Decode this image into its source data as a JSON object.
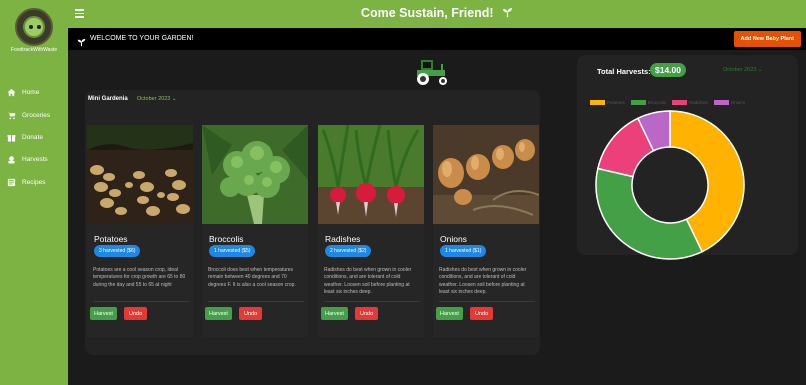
{
  "sidebar": {
    "brand": "FoodtrackWithWaste",
    "items": [
      {
        "label": "Home",
        "icon": "home-icon"
      },
      {
        "label": "Groceries",
        "icon": "cart-icon"
      },
      {
        "label": "Donate",
        "icon": "gift-icon"
      },
      {
        "label": "Harvests",
        "icon": "harvest-icon"
      },
      {
        "label": "Recipes",
        "icon": "recipes-icon"
      }
    ]
  },
  "header": {
    "title": "Come Sustain, Friend!",
    "sprout_icon": "sprout-icon",
    "menu_icon": "menu-icon"
  },
  "welcome": {
    "text": "WELCOME TO YOUR GARDEN!",
    "add_button": "Add New Baby Plant"
  },
  "garden": {
    "name": "Mini Gardenia",
    "month": "October 2023",
    "cards": [
      {
        "title": "Potatoes",
        "badge": "3 harvested ($6)",
        "description": "Potatoes are a cool season crop, ideal temperatures for crop growth are 65 to 80 during the day and 55 to 65 at night",
        "harvest": "Harvest",
        "undo": "Undo"
      },
      {
        "title": "Broccolis",
        "badge": "1 harvested ($5)",
        "description": "Broccoli does best when temperatures remain between 40 degrees and 70 degrees F. It is also a cool season crop.",
        "harvest": "Harvest",
        "undo": "Undo"
      },
      {
        "title": "Radishes",
        "badge": "2 harvested ($2)",
        "description": "Radishes do best when grown in cooler conditions, and are tolerant of cold weather. Loosen soil before planting at least six inches deep.",
        "harvest": "Harvest",
        "undo": "Undo"
      },
      {
        "title": "Onions",
        "badge": "1 harvested ($1)",
        "description": "Radishes do best when grown in cooler conditions, and are tolerant of cold weather. Loosen soil before planting at least six inches deep.",
        "harvest": "Harvest",
        "undo": "Undo"
      }
    ]
  },
  "harvest_summary": {
    "label": "Total Harvests:",
    "total": "$14.00",
    "month": "October 2023"
  },
  "chart_data": {
    "type": "pie",
    "categories": [
      "Potatoes",
      "Broccolis",
      "Radishes",
      "Onions"
    ],
    "values": [
      6,
      5,
      2,
      1
    ],
    "colors": [
      "#ffb300",
      "#43a047",
      "#ec407a",
      "#ba68c8"
    ],
    "legend_position": "top"
  }
}
